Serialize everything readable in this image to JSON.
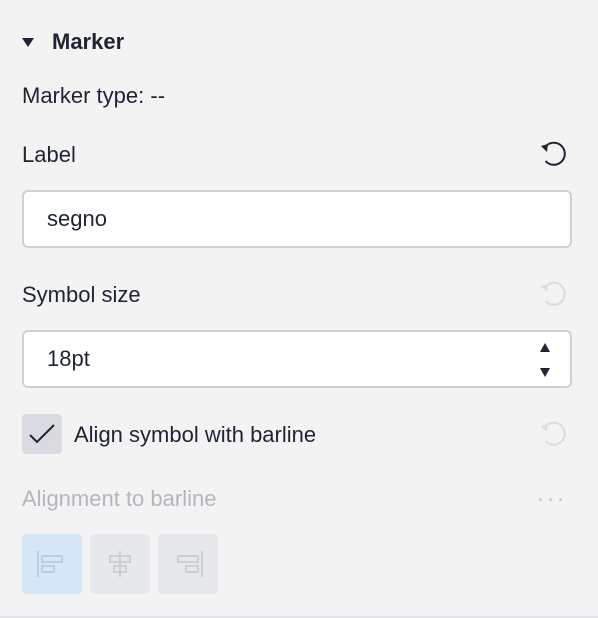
{
  "section": {
    "title": "Marker"
  },
  "marker_type": {
    "text": "Marker type: --"
  },
  "label_field": {
    "label": "Label",
    "value": "segno"
  },
  "symbol_size": {
    "label": "Symbol size",
    "value": "18pt"
  },
  "align_checkbox": {
    "label": "Align symbol with barline",
    "checked": true
  },
  "alignment": {
    "label": "Alignment to barline",
    "options": [
      "align-left",
      "align-center",
      "align-right"
    ],
    "selected": "align-left"
  },
  "colors": {
    "panel_bg": "#f3f3f4",
    "text": "#1f2433",
    "disabled_text": "#b3b6bf",
    "selected_button": "#d6e6f6"
  }
}
